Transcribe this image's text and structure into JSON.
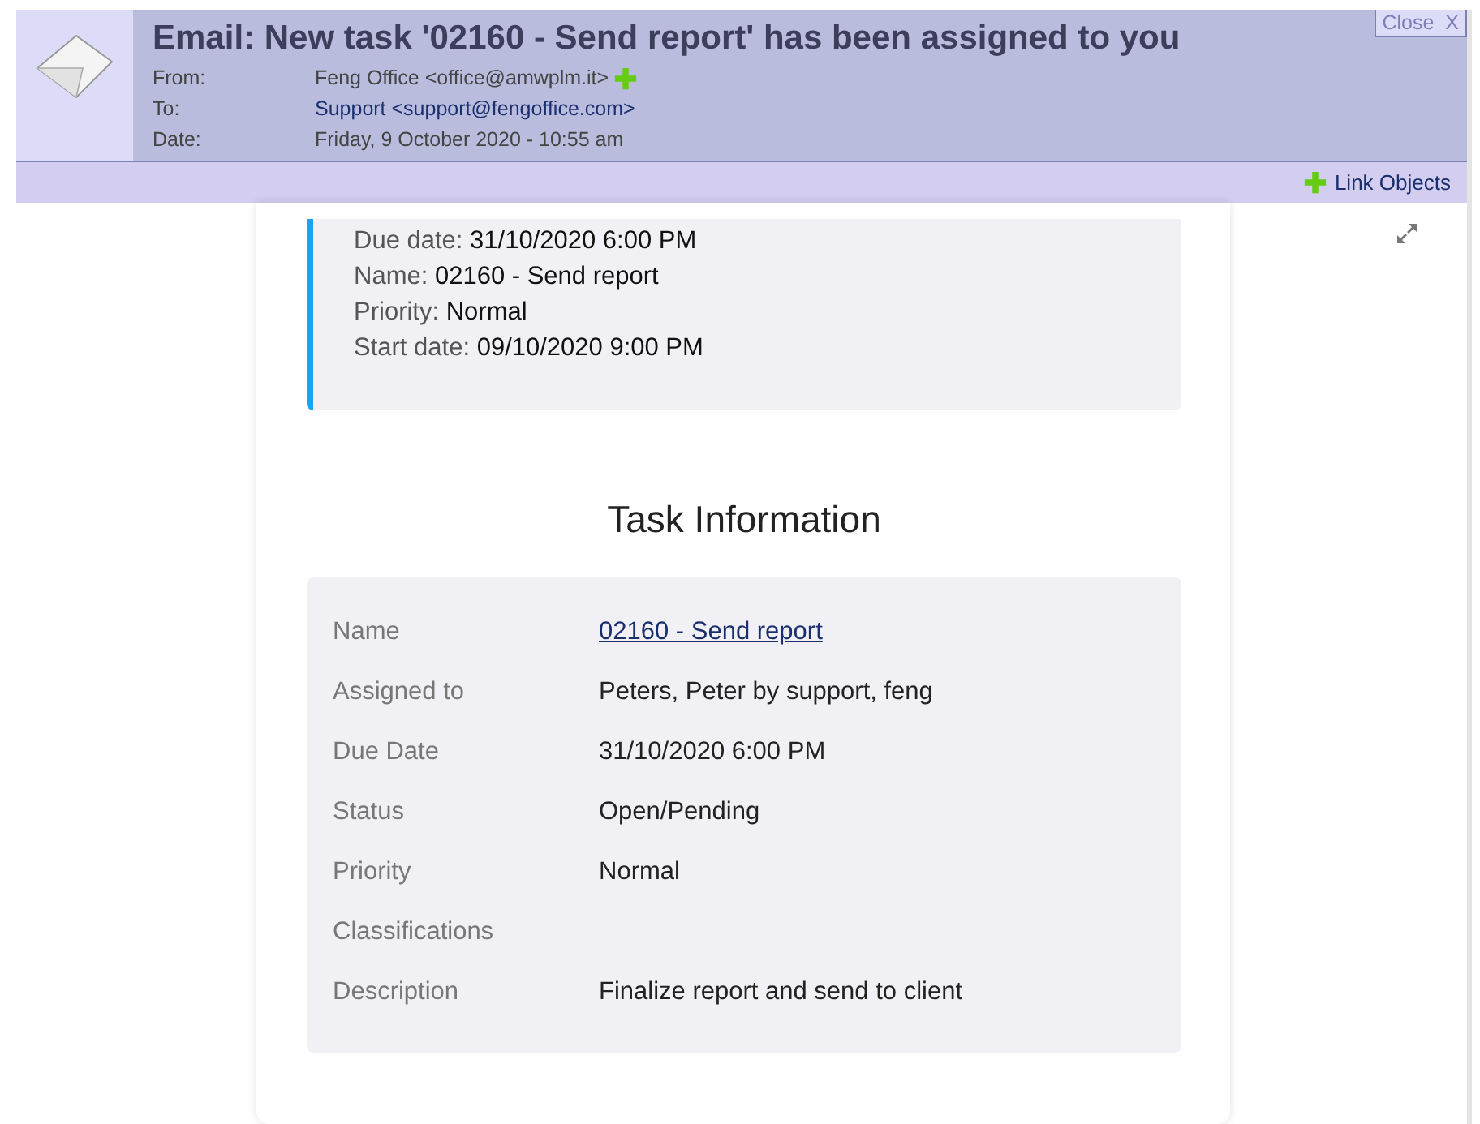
{
  "header": {
    "title": "Email: New task '02160 - Send report' has been assigned to you",
    "close": "Close  X",
    "fields": [
      {
        "kind": "plain",
        "label": "From:",
        "value": "Feng Office <office@amwplm.it>",
        "add": true
      },
      {
        "kind": "link",
        "label": "To:",
        "value": "Support <support@fengoffice.com>",
        "add": false
      },
      {
        "kind": "plain",
        "label": "Date:",
        "value": "Friday, 9 October 2020 - 10:55 am",
        "add": false
      }
    ]
  },
  "toolbar": {
    "link_objects": "Link Objects"
  },
  "summary": [
    {
      "label": "Due date: ",
      "value": "31/10/2020 6:00 PM"
    },
    {
      "label": "Name: ",
      "value": "02160 - Send report"
    },
    {
      "label": "Priority: ",
      "value": "Normal"
    },
    {
      "label": "Start date: ",
      "value": "09/10/2020 9:00 PM"
    }
  ],
  "task_info": {
    "heading": "Task Information",
    "rows": [
      {
        "kind": "link",
        "label": "Name",
        "value": "02160 - Send report"
      },
      {
        "kind": "text",
        "label": "Assigned to",
        "value": "Peters, Peter by support, feng"
      },
      {
        "kind": "text",
        "label": "Due Date",
        "value": "31/10/2020 6:00 PM"
      },
      {
        "kind": "text",
        "label": "Status",
        "value": "Open/Pending"
      },
      {
        "kind": "text",
        "label": "Priority",
        "value": "Normal"
      },
      {
        "kind": "text",
        "label": "Classifications"
      },
      {
        "kind": "text",
        "label": "Description",
        "value": "Finalize report and send to client"
      }
    ]
  }
}
